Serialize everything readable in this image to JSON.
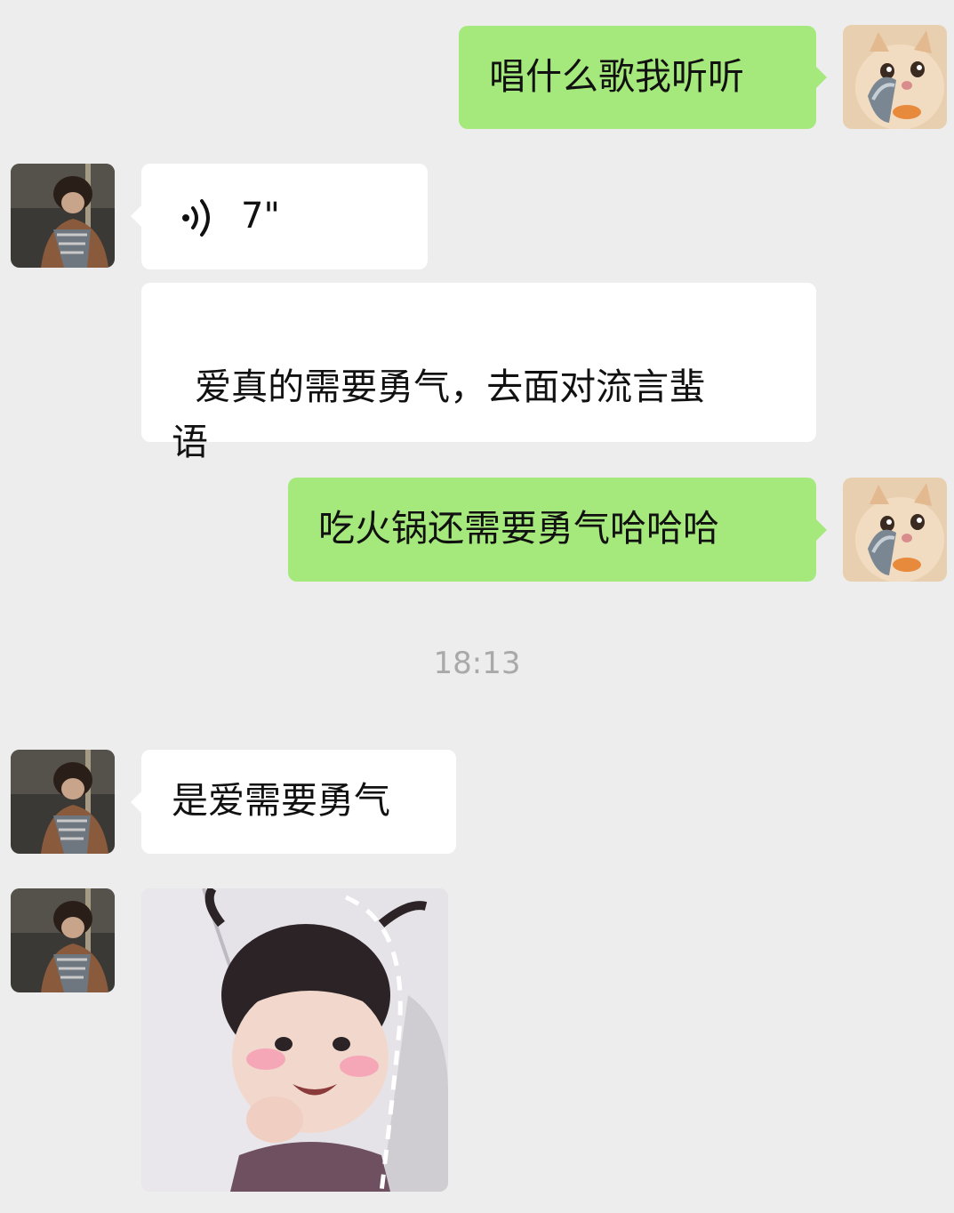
{
  "messages": [
    {
      "side": "out",
      "text": "唱什么歌我听听"
    },
    {
      "side": "in",
      "type": "voice",
      "duration": "7\""
    },
    {
      "side": "in",
      "text": "爱真的需要勇气，去面对流言蜚\n语"
    },
    {
      "side": "out",
      "text": "吃火锅还需要勇气哈哈哈"
    },
    {
      "side": "in",
      "text": "是爱需要勇气"
    },
    {
      "side": "in",
      "type": "sticker",
      "sticker": "little-girl-peeking-sticker"
    }
  ],
  "timestamp": "18:13",
  "colors": {
    "background": "#ededed",
    "outgoing_bubble": "#a5e87c",
    "incoming_bubble": "#ffffff",
    "timestamp_text": "#a9a9a9"
  },
  "icons": {
    "voice": "voice-wave-icon",
    "self_avatar": "cat-avatar",
    "contact_avatar": "person-avatar"
  }
}
